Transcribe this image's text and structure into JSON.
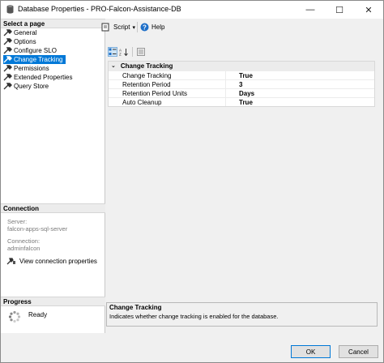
{
  "window": {
    "title": "Database Properties - PRO-Falcon-Assistance-DB",
    "minimize_glyph": "—",
    "maximize_glyph": "☐",
    "close_glyph": "✕"
  },
  "sidebar": {
    "select_page_header": "Select a page",
    "pages": [
      {
        "label": "General",
        "icon": "wrench-icon"
      },
      {
        "label": "Options",
        "icon": "wrench-icon"
      },
      {
        "label": "Configure SLO",
        "icon": "wrench-icon"
      },
      {
        "label": "Change Tracking",
        "icon": "wrench-icon",
        "selected": true
      },
      {
        "label": "Permissions",
        "icon": "wrench-icon"
      },
      {
        "label": "Extended Properties",
        "icon": "wrench-icon"
      },
      {
        "label": "Query Store",
        "icon": "wrench-icon"
      }
    ],
    "connection": {
      "header": "Connection",
      "server_label": "Server:",
      "server_value": "falcon-apps-sql-server",
      "connection_label": "Connection:",
      "connection_value": "adminfalcon",
      "view_link": "View connection properties"
    },
    "progress": {
      "header": "Progress",
      "status": "Ready"
    }
  },
  "toolbar": {
    "script_label": "Script",
    "help_label": "Help"
  },
  "property_grid": {
    "category": "Change Tracking",
    "rows": [
      {
        "name": "Change Tracking",
        "value": "True"
      },
      {
        "name": "Retention Period",
        "value": "3"
      },
      {
        "name": "Retention Period Units",
        "value": "Days"
      },
      {
        "name": "Auto Cleanup",
        "value": "True"
      }
    ]
  },
  "description": {
    "title": "Change Tracking",
    "text": "Indicates whether change tracking is enabled for the database."
  },
  "buttons": {
    "ok": "OK",
    "cancel": "Cancel"
  },
  "colors": {
    "accent": "#0078d7",
    "window_bg": "#f0f0f0"
  }
}
